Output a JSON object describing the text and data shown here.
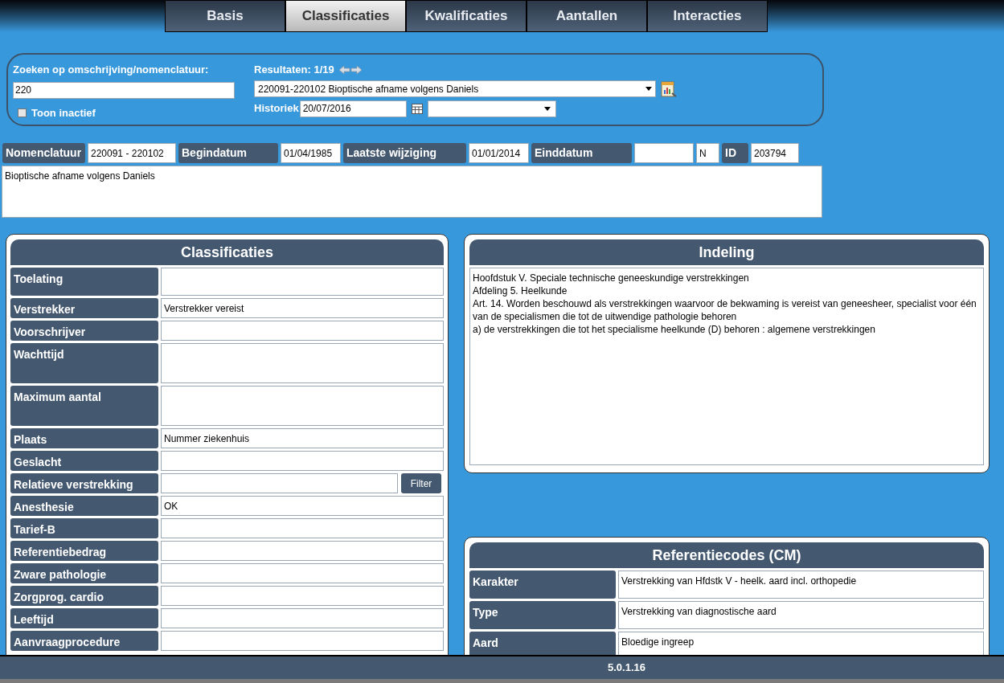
{
  "tabs": [
    {
      "label": "Basis",
      "selected": false
    },
    {
      "label": "Classificaties",
      "selected": true
    },
    {
      "label": "Kwalificaties",
      "selected": false
    },
    {
      "label": "Aantallen",
      "selected": false
    },
    {
      "label": "Interacties",
      "selected": false
    }
  ],
  "search": {
    "label": "Zoeken op omschrijving/nomenclatuur:",
    "value": "220",
    "inactive_label": "Toon inactief",
    "inactive_checked": false,
    "results_label": "Resultaten: 1/19",
    "result": "220091-220102 Bioptische afname volgens Daniels",
    "history_label": "Historiek",
    "history_date": "20/07/2016"
  },
  "header_fields": [
    {
      "label": "Nomenclatuur",
      "value": "220091 - 220102"
    },
    {
      "label": "Begindatum",
      "value": "01/04/1985"
    },
    {
      "label": "Laatste wijziging",
      "value": "01/01/2014"
    },
    {
      "label": "Einddatum",
      "extra": "N"
    },
    {
      "label": "ID",
      "value": "203794"
    }
  ],
  "description": "Bioptische afname volgens Daniels",
  "classificaties": {
    "title": "Classificaties",
    "rows": [
      {
        "label": "Toelating",
        "kind": "medium"
      },
      {
        "label": "Verstrekker",
        "value": "Verstrekker vereist",
        "kind": "short"
      },
      {
        "label": "Voorschrijver",
        "kind": "short"
      },
      {
        "label": "Wachttijd",
        "kind": "tall"
      },
      {
        "label": "Maximum aantal",
        "kind": "tall"
      },
      {
        "label": "Plaats",
        "value": "Nummer ziekenhuis",
        "kind": "short"
      },
      {
        "label": "Geslacht",
        "kind": "short"
      },
      {
        "label": "Relatieve verstrekking",
        "kind": "filter",
        "button": "Filter"
      },
      {
        "label": "Anesthesie",
        "value": "OK",
        "kind": "short"
      },
      {
        "label": "Tarief-B",
        "kind": "short"
      },
      {
        "label": "Referentiebedrag",
        "kind": "short"
      },
      {
        "label": "Zware pathologie",
        "kind": "short"
      },
      {
        "label": "Zorgprog. cardio",
        "kind": "short"
      },
      {
        "label": "Leeftijd",
        "kind": "short"
      },
      {
        "label": "Aanvraagprocedure",
        "kind": "short"
      }
    ]
  },
  "indeling": {
    "title": "Indeling",
    "lines": [
      "Hoofdstuk V. Speciale technische geneeskundige verstrekkingen",
      "Afdeling 5. Heelkunde",
      "Art. 14. Worden beschouwd als verstrekkingen waarvoor de bekwaming is vereist van geneesheer, specialist voor één van de specialismen die tot de uitwendige pathologie behoren",
      "a) de verstrekkingen die tot het specialisme heelkunde (D) behoren : algemene verstrekkingen"
    ]
  },
  "referentiecodes": {
    "title": "Referentiecodes (CM)",
    "rows": [
      {
        "label": "Karakter",
        "value": "Verstrekking van Hfdstk V - heelk. aard incl. orthopedie"
      },
      {
        "label": "Type",
        "value": "Verstrekking van diagnostische aard"
      },
      {
        "label": "Aard",
        "value": "Bloedige ingreep"
      }
    ]
  },
  "status_bar": {
    "version": "5.0.1.16"
  }
}
